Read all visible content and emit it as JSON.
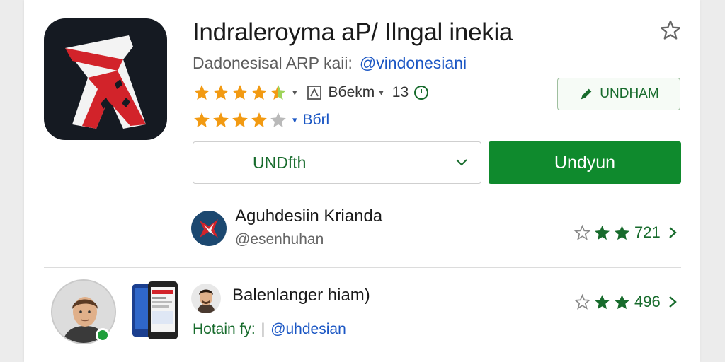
{
  "app": {
    "title": "Indraleroyma aP/ Ilngal inekia",
    "subtitle": "Dadonesisal ARP kaii:",
    "handle": "@vindonesiani",
    "rating_primary": 4.5,
    "rating_secondary": 4,
    "downloads_text": "Bбekm",
    "version_text": "13",
    "secondary_link": "Bбrl",
    "small_button_label": "UNDHAM",
    "select_value": "UNDfth",
    "primary_button_label": "Undyun",
    "icon_name": "app-logo-icon"
  },
  "developer": {
    "name": "Aguhdesiin Krianda",
    "handle": "@esenhuhan",
    "rating_stars": 2,
    "rating_value": "721"
  },
  "user": {
    "name": "Balenlanger hiam)",
    "footer_label": "Hotain fy:",
    "footer_separator": "|",
    "footer_handle": "@uhdesian",
    "rating_stars": 2,
    "rating_value": "496"
  },
  "colors": {
    "accent_green": "#0f8a2d",
    "link_blue": "#1a56c4",
    "star_orange": "#f29a12",
    "star_gray": "#b9b9b9",
    "star_green": "#176b2c",
    "logo_red": "#d2232a"
  }
}
